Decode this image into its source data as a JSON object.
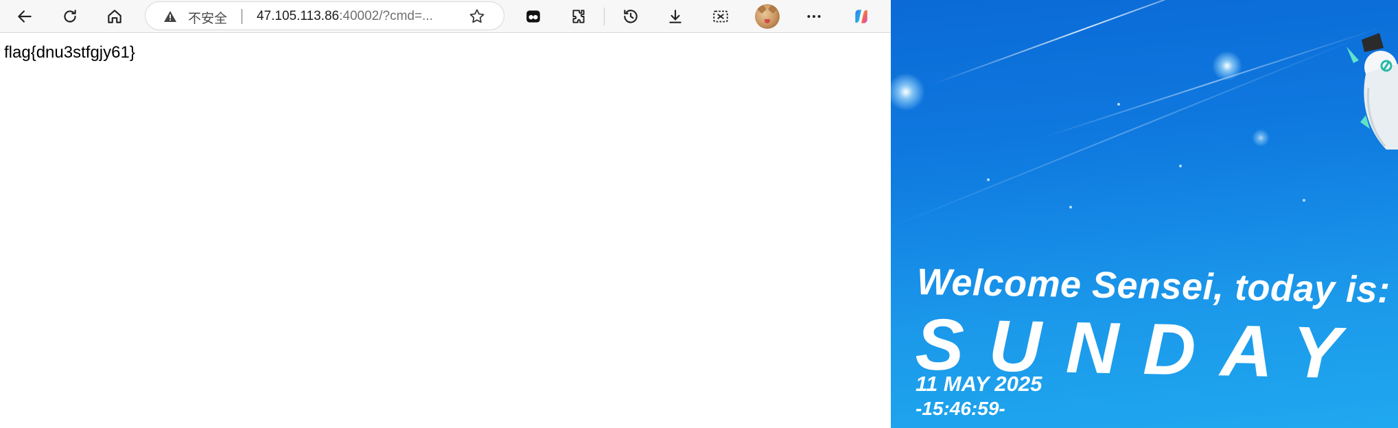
{
  "toolbar": {
    "back_icon": "back-arrow-icon",
    "refresh_icon": "refresh-icon",
    "home_icon": "home-icon",
    "address": {
      "security_label": "不安全",
      "url_host": "47.105.113.86",
      "url_rest": ":40002/?cmd=..."
    },
    "favorite_icon": "star-icon",
    "extensions": [
      "tab-manager-icon",
      "extensions-puzzle-icon",
      "history-icon",
      "download-icon",
      "screenshot-icon",
      "profile-avatar",
      "more-icon",
      "copilot-icon"
    ]
  },
  "page": {
    "body_text": "flag{dnu3stfgjy61}"
  },
  "wallpaper": {
    "greeting": "Welcome Sensei, today is:",
    "day": "SUNDAY",
    "date": "11 MAY 2025",
    "time": "-15:46:59-"
  },
  "colors": {
    "toolbar_bg": "#f7f7f7",
    "wallpaper_blue": "#1b98ea"
  }
}
